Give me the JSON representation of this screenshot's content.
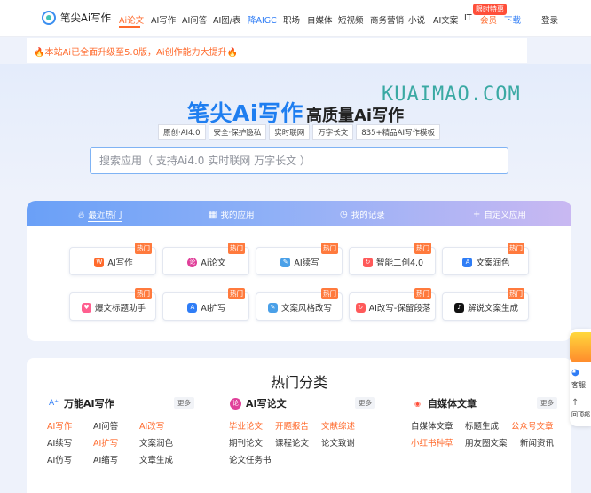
{
  "brand": {
    "name": "笔尖Ai写作",
    "accent": "#1f7ef0",
    "orange": "#ff6a2c"
  },
  "nav": {
    "items": [
      "Ai论文",
      "AI写作",
      "AI问答",
      "AI图/表",
      "降AIGC",
      "职场",
      "自媒体",
      "短视频",
      "商务营销",
      "小说",
      "AI文案",
      "IT",
      "会员",
      "下载"
    ],
    "sale_badge": "限时特惠",
    "login": "登录"
  },
  "notice": "🔥本站Ai已全面升级至5.0版，Ai创作能力大提升🔥",
  "hero": {
    "title": "笔尖Ai写作",
    "subtitle": "高质量Ai写作",
    "watermark": "KUAIMAO.COM",
    "tags": [
      "原创·AI4.0",
      "安全·保护隐私",
      "实时联网",
      "万字长文",
      "835+精品AI写作模板"
    ],
    "search_placeholder": "搜索应用（ 支持Ai4.0 实时联网 万字长文 ）"
  },
  "tabs": [
    "最近热门",
    "我的应用",
    "我的记录",
    "自定义应用"
  ],
  "hot_label": "热门",
  "cards": [
    {
      "label": "AI写作",
      "icon": "write-icon",
      "color": "#ff6a2c"
    },
    {
      "label": "Ai论文",
      "icon": "paper-icon",
      "color": "#e0409a"
    },
    {
      "label": "AI续写",
      "icon": "continue-icon",
      "color": "#4aa0e8"
    },
    {
      "label": "智能二创4.0",
      "icon": "rewrite-icon",
      "color": "#ff5a5a"
    },
    {
      "label": "文案润色",
      "icon": "polish-icon",
      "color": "#2f7df6"
    },
    {
      "label": "爆文标题助手",
      "icon": "title-icon",
      "color": "#ff5f8f"
    },
    {
      "label": "AI扩写",
      "icon": "expand-icon",
      "color": "#2f7df6"
    },
    {
      "label": "文案风格改写",
      "icon": "style-icon",
      "color": "#4aa0e8"
    },
    {
      "label": "AI改写-保留段落",
      "icon": "paragraph-icon",
      "color": "#ff5a5a"
    },
    {
      "label": "解说文案生成",
      "icon": "tiktok-icon",
      "color": "#111111"
    }
  ],
  "categories": {
    "title": "热门分类",
    "more": "更多",
    "columns": [
      {
        "title": "万能AI写作",
        "links": [
          "AI写作",
          "AI问答",
          "AI改写",
          "AI续写",
          "AI扩写",
          "文案润色",
          "AI仿写",
          "AI缩写",
          "文章生成"
        ]
      },
      {
        "title": "AI写论文",
        "links": [
          "毕业论文",
          "开题报告",
          "文献综述",
          "期刊论文",
          "课程论文",
          "论文致谢",
          "论文任务书"
        ]
      },
      {
        "title": "自媒体文章",
        "links": [
          "自媒体文章",
          "标题生成",
          "公众号文章",
          "小红书种草",
          "朋友圈文案",
          "新闻资讯"
        ]
      }
    ]
  },
  "float": {
    "top": "客服",
    "bottom": "回顶部"
  }
}
